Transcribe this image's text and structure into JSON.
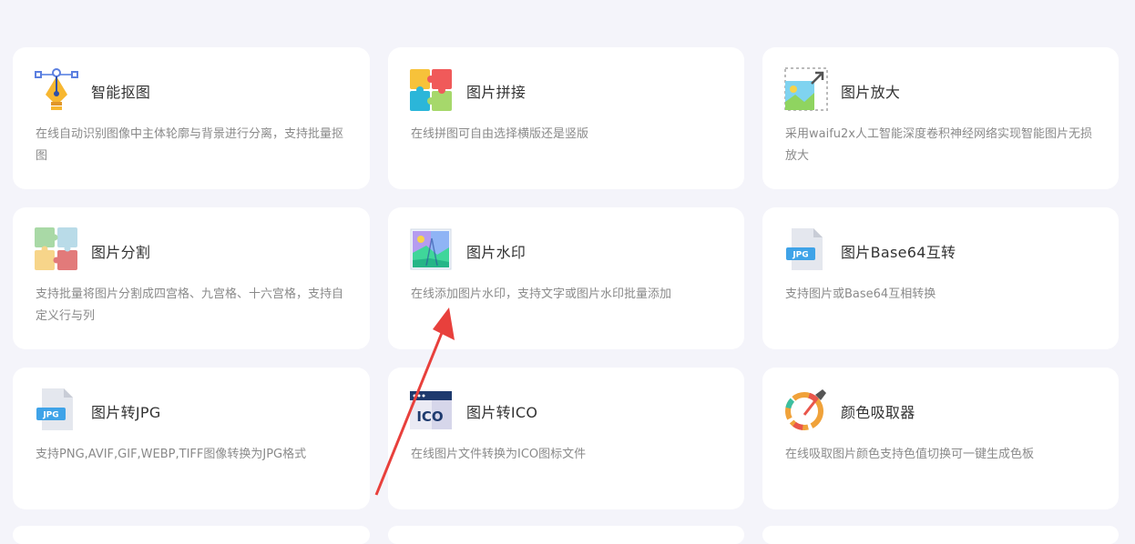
{
  "tools": [
    {
      "title": "智能抠图",
      "desc": "在线自动识别图像中主体轮廓与背景进行分离，支持批量抠图",
      "icon": "pen-tool-icon"
    },
    {
      "title": "图片拼接",
      "desc": "在线拼图可自由选择横版还是竖版",
      "icon": "puzzle-icon"
    },
    {
      "title": "图片放大",
      "desc": "采用waifu2x人工智能深度卷积神经网络实现智能图片无损放大",
      "icon": "image-enlarge-icon"
    },
    {
      "title": "图片分割",
      "desc": "支持批量将图片分割成四宫格、九宫格、十六宫格，支持自定义行与列",
      "icon": "puzzle-split-icon"
    },
    {
      "title": "图片水印",
      "desc": "在线添加图片水印，支持文字或图片水印批量添加",
      "icon": "watermark-image-icon"
    },
    {
      "title": "图片Base64互转",
      "desc": "支持图片或Base64互相转换",
      "icon": "jpg-file-icon"
    },
    {
      "title": "图片转JPG",
      "desc": "支持PNG,AVIF,GIF,WEBP,TIFF图像转换为JPG格式",
      "icon": "jpg-file-icon"
    },
    {
      "title": "图片转ICO",
      "desc": "在线图片文件转换为ICO图标文件",
      "icon": "ico-file-icon"
    },
    {
      "title": "颜色吸取器",
      "desc": "在线吸取图片颜色支持色值切换可一键生成色板",
      "icon": "color-picker-icon"
    }
  ],
  "icon_labels": {
    "jpg": "JPG",
    "ico": "ICO"
  },
  "colors": {
    "background": "#f4f4fa",
    "card": "#ffffff",
    "title": "#333333",
    "desc": "#8a8a8a",
    "arrow": "#e8403c"
  }
}
